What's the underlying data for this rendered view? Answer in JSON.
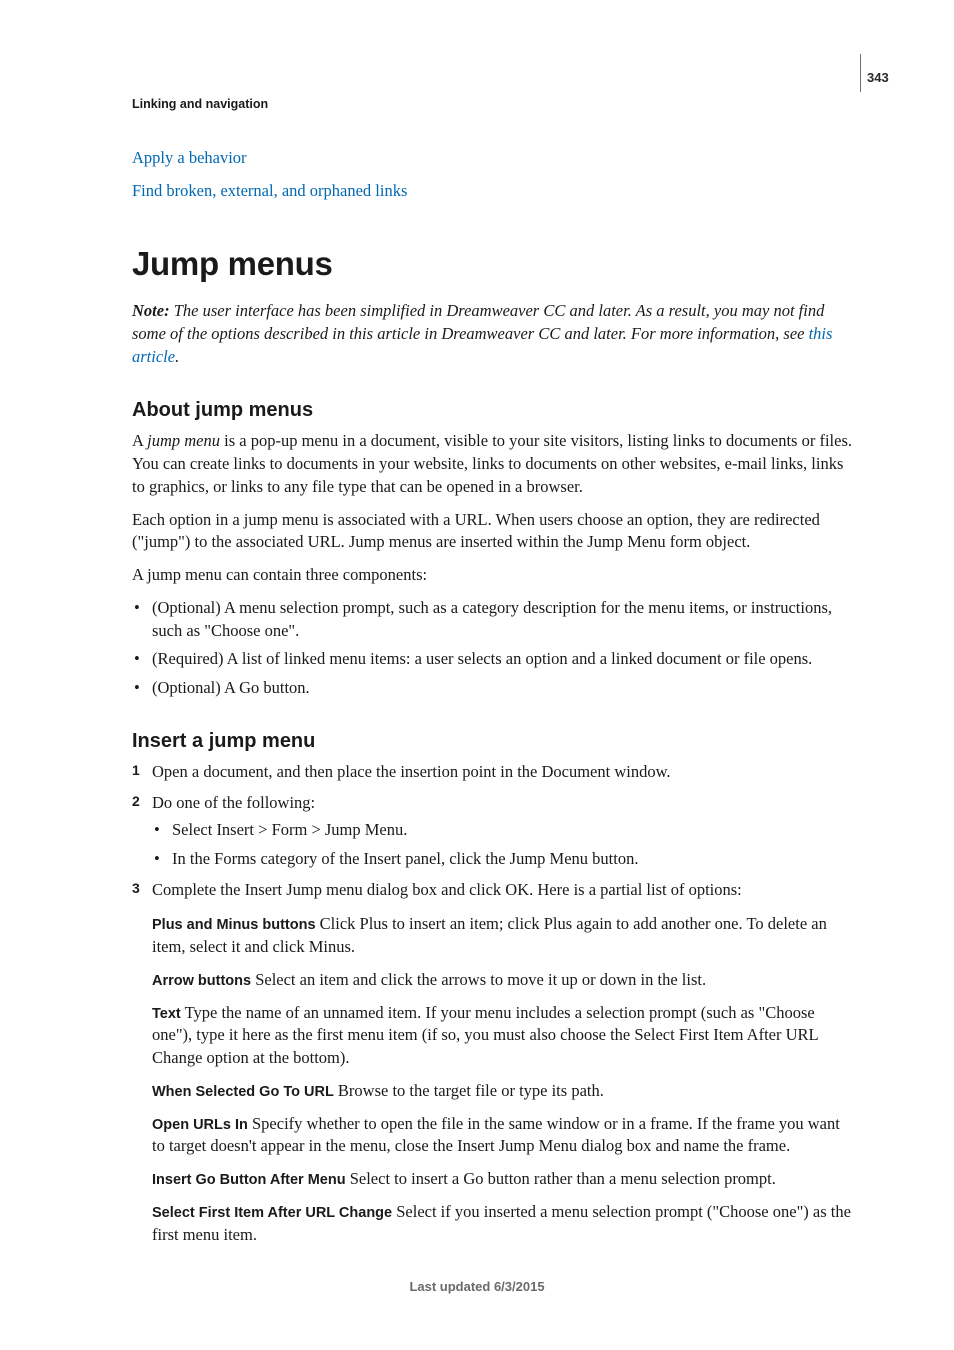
{
  "pageNumber": "343",
  "runningHead": "Linking and navigation",
  "topLinks": {
    "apply": "Apply a behavior",
    "find": "Find broken, external, and orphaned links"
  },
  "h1": "Jump menus",
  "note": {
    "label": "Note: ",
    "body_a": "The user interface has been simplified in Dreamweaver CC and later. As a result, you may not find some of the options described in this article in Dreamweaver CC and later. For more information, see ",
    "linkText": "this article",
    "body_b": "."
  },
  "about": {
    "heading": "About jump menus",
    "p1_a": "A ",
    "p1_term": "jump menu",
    "p1_b": " is a pop-up menu in a document, visible to your site visitors, listing links to documents or files. You can create links to documents in your website, links to documents on other websites, e-mail links, links to graphics, or links to any file type that can be opened in a browser.",
    "p2": "Each option in a jump menu is associated with a URL. When users choose an option, they are redirected (\"jump\") to the associated URL. Jump menus are inserted within the Jump Menu form object.",
    "p3": "A jump menu can contain three components:",
    "bullets": [
      "(Optional) A menu selection prompt, such as a category description for the menu items, or instructions, such as \"Choose one\".",
      "(Required) A list of linked menu items: a user selects an option and a linked document or file opens.",
      "(Optional) A Go button."
    ]
  },
  "insert": {
    "heading": "Insert a jump menu",
    "steps": {
      "s1": "Open a document, and then place the insertion point in the Document window.",
      "s2": "Do one of the following:",
      "s2_sub": [
        "Select Insert > Form > Jump Menu.",
        "In the Forms category of the Insert panel, click the Jump Menu button."
      ],
      "s3": "Complete the Insert Jump menu dialog box and click OK. Here is a partial list of options:"
    },
    "defs": [
      {
        "label": "Plus and Minus buttons",
        "text": "  Click Plus to insert an item; click Plus again to add another one. To delete an item, select it and click Minus."
      },
      {
        "label": "Arrow buttons",
        "text": "  Select an item and click the arrows to move it up or down in the list."
      },
      {
        "label": "Text",
        "text": "  Type the name of an unnamed item. If your menu includes a selection prompt (such as \"Choose one\"), type it here as the first menu item (if so, you must also choose the Select First Item After URL Change option at the bottom)."
      },
      {
        "label": "When Selected Go To URL",
        "text": "  Browse to the target file or type its path."
      },
      {
        "label": "Open URLs In",
        "text": "  Specify whether to open the file in the same window or in a frame. If the frame you want to target doesn't appear in the menu, close the Insert Jump Menu dialog box and name the frame."
      },
      {
        "label": "Insert Go Button After Menu",
        "text": "  Select to insert a Go button rather than a menu selection prompt."
      },
      {
        "label": "Select First Item After URL Change",
        "text": "  Select if you inserted a menu selection prompt (\"Choose one\") as the first menu item."
      }
    ]
  },
  "footer": "Last updated 6/3/2015"
}
